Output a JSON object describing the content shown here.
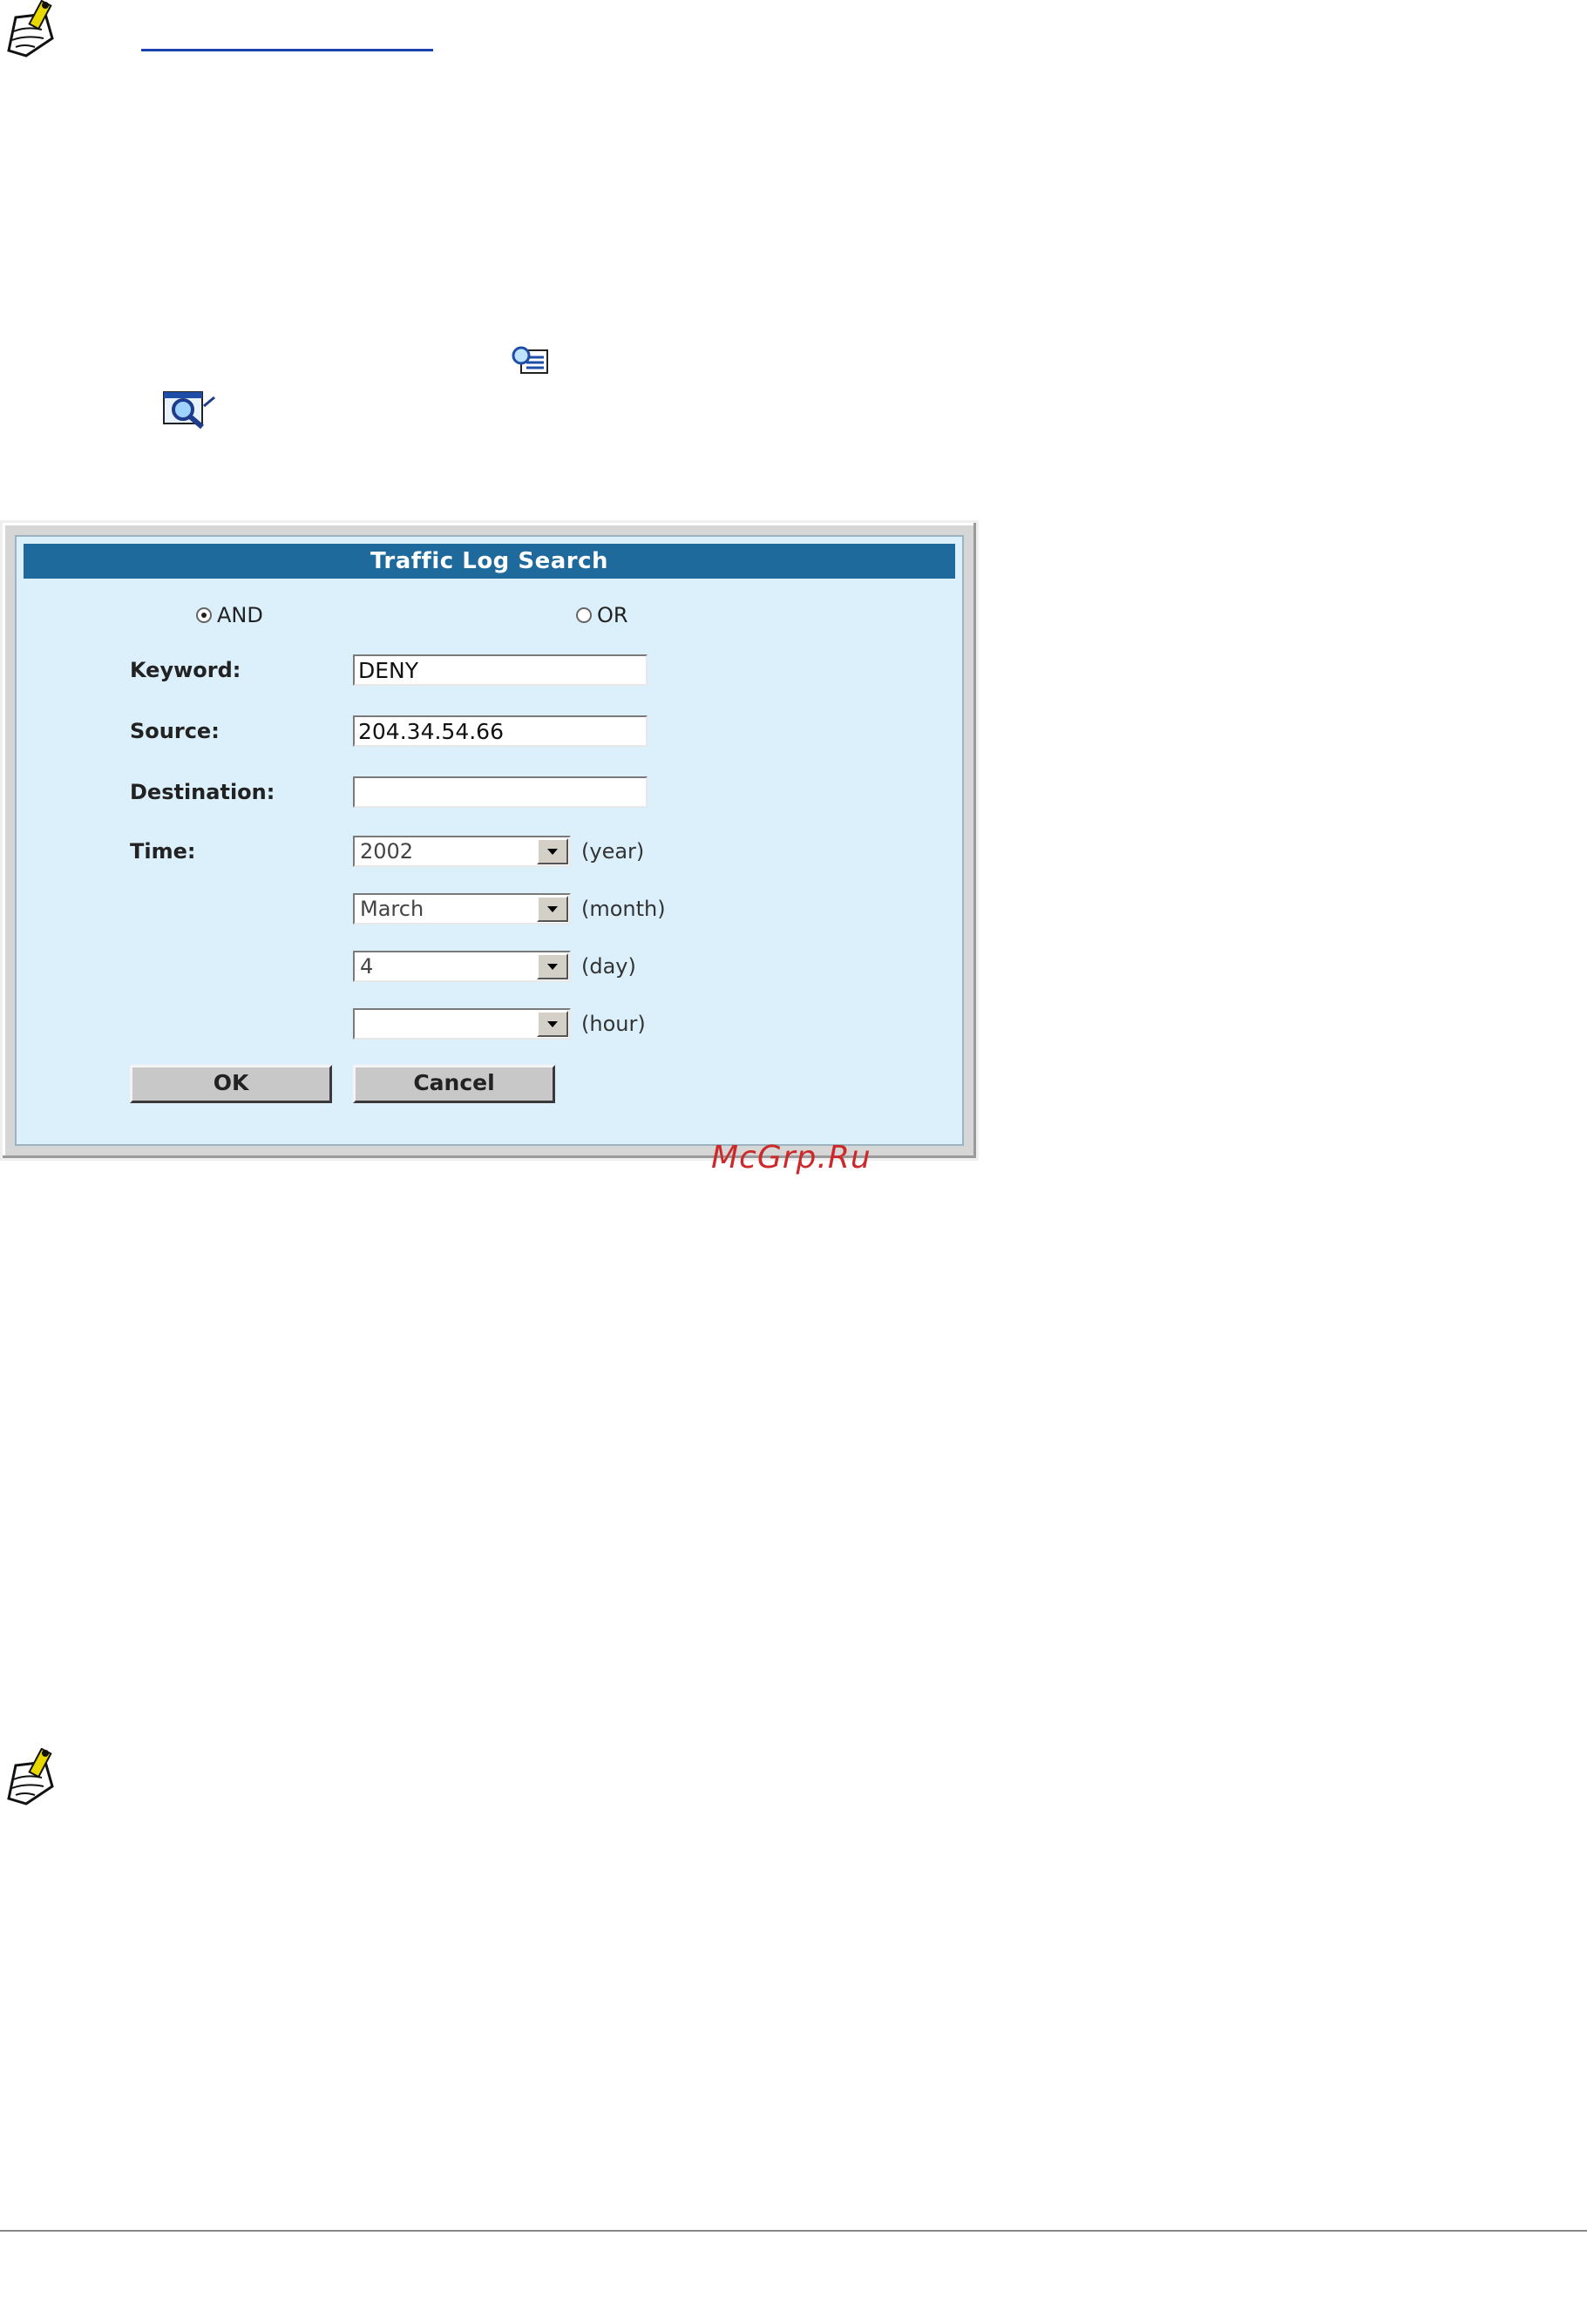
{
  "dialog": {
    "title": "Traffic Log Search",
    "match": {
      "and_label": "AND",
      "or_label": "OR",
      "selected": "AND"
    },
    "fields": {
      "keyword_label": "Keyword:",
      "keyword_value": "DENY",
      "source_label": "Source:",
      "source_value": "204.34.54.66",
      "destination_label": "Destination:",
      "destination_value": ""
    },
    "time": {
      "label": "Time:",
      "year_value": "2002",
      "year_unit": "(year)",
      "month_value": "March",
      "month_unit": "(month)",
      "day_value": "4",
      "day_unit": "(day)",
      "hour_value": "",
      "hour_unit": "(hour)"
    },
    "buttons": {
      "ok_label": "OK",
      "cancel_label": "Cancel"
    }
  },
  "watermark": "McGrp.Ru",
  "icons": {
    "note_top": "note-pencil-icon",
    "inline_1": "search-list-icon",
    "inline_2": "magnifier-document-icon",
    "note_bottom": "note-pencil-icon"
  }
}
